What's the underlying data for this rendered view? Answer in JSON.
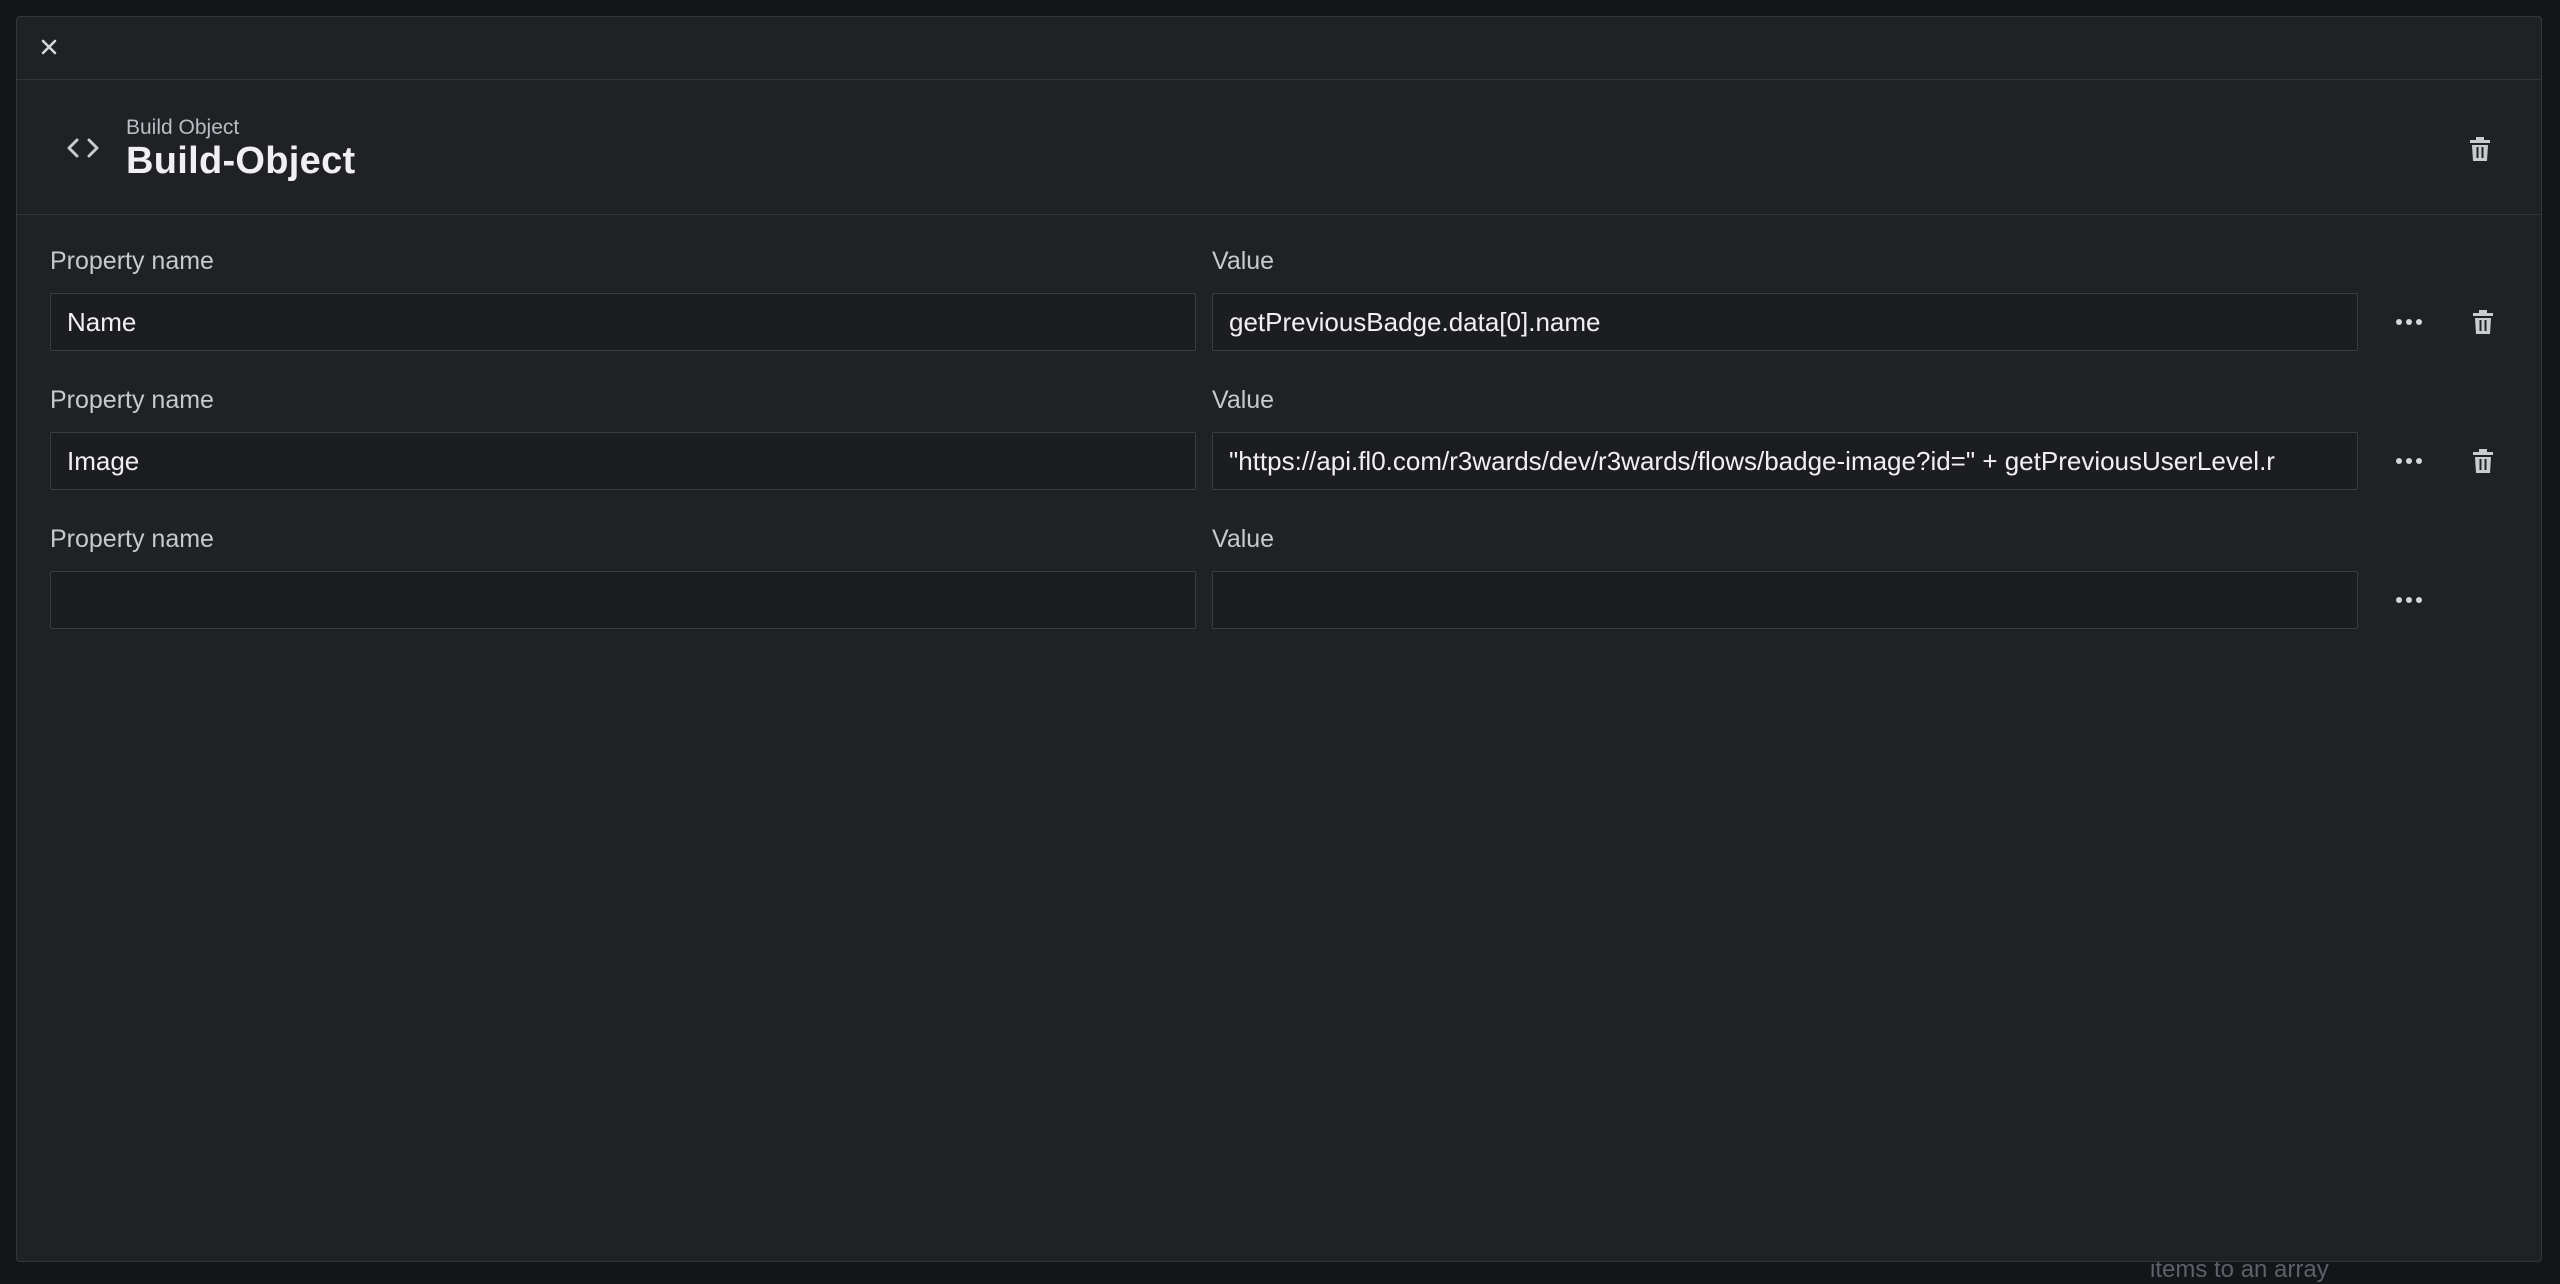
{
  "backdrop": {
    "text": "items to an array"
  },
  "header": {
    "subtitle": "Build Object",
    "title": "Build-Object"
  },
  "labels": {
    "property_name": "Property name",
    "value": "Value"
  },
  "rows": [
    {
      "property_name": "Name",
      "value": "getPreviousBadge.data[0].name"
    },
    {
      "property_name": "Image",
      "value": "\"https://api.fl0.com/r3wards/dev/r3wards/flows/badge-image?id=\" + getPreviousUserLevel.r"
    },
    {
      "property_name": "",
      "value": ""
    }
  ],
  "icons": {
    "close": "close-icon",
    "code": "code-icon",
    "more": "more-icon",
    "trash": "trash-icon"
  },
  "colors": {
    "modal_bg": "#202125",
    "field_bg": "#1c1d20",
    "border": "#3a3c42",
    "text": "#f0f0f2",
    "muted": "#c7c9ce"
  }
}
